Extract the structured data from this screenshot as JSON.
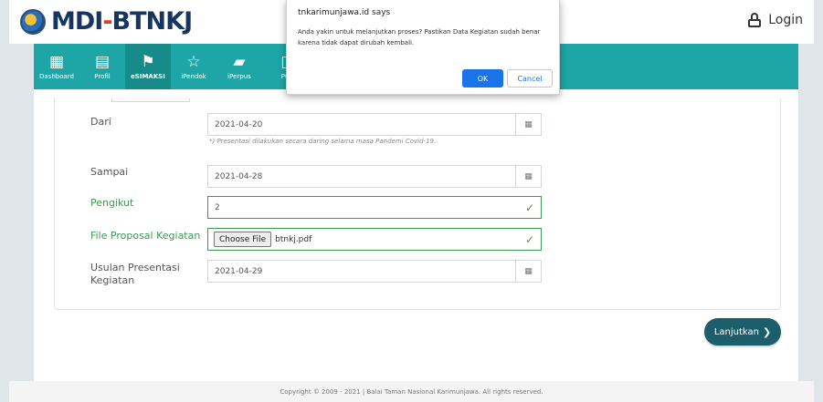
{
  "brand": {
    "name_part1": "MDI",
    "name_dash": "-",
    "name_part2": "BTNKJ"
  },
  "header": {
    "login_label": "Login"
  },
  "nav": {
    "items": [
      {
        "label": "Dashboard",
        "icon": "dashboard-grid-icon"
      },
      {
        "label": "Profil",
        "icon": "document-icon"
      },
      {
        "label": "eSIMAKSI",
        "icon": "map-signs-icon"
      },
      {
        "label": "iPendok",
        "icon": "star-icon"
      },
      {
        "label": "iPerpus",
        "icon": "book-icon"
      },
      {
        "label": "Pu",
        "icon": "document-icon"
      }
    ],
    "active": "eSIMAKSI"
  },
  "form": {
    "dari": {
      "label": "Dari",
      "value": "2021-04-20"
    },
    "hint": "*) Presentasi dilakukan secara daring selama masa Pandemi Covid-19.",
    "sampai": {
      "label": "Sampai",
      "value": "2021-04-28"
    },
    "pengikut": {
      "label": "Pengikut",
      "value": "2"
    },
    "proposal": {
      "label": "File Proposal Kegiatan",
      "button": "Choose File",
      "filename": "btnkj.pdf"
    },
    "usulan": {
      "label_line1": "Usulan Presentasi",
      "label_line2": "Kegiatan",
      "value": "2021-04-29"
    },
    "next_label": "Lanjutkan"
  },
  "dialog": {
    "title": "tnkarimunjawa.id says",
    "message": "Anda yakin untuk melanjutkan proses? Pastikan Data Kegiatan sudah benar karena tidak dapat dirubah kembali.",
    "ok": "OK",
    "cancel": "Cancel"
  },
  "footer": {
    "text": "Copyright © 2009 - 2021 | Balai Taman Nasional Karimunjawa. All rights reserved."
  },
  "colors": {
    "nav": "#1ea6a6",
    "success": "#3c9a52",
    "primary_button": "#1c5e6b",
    "dialog_ok": "#1a73e8"
  }
}
